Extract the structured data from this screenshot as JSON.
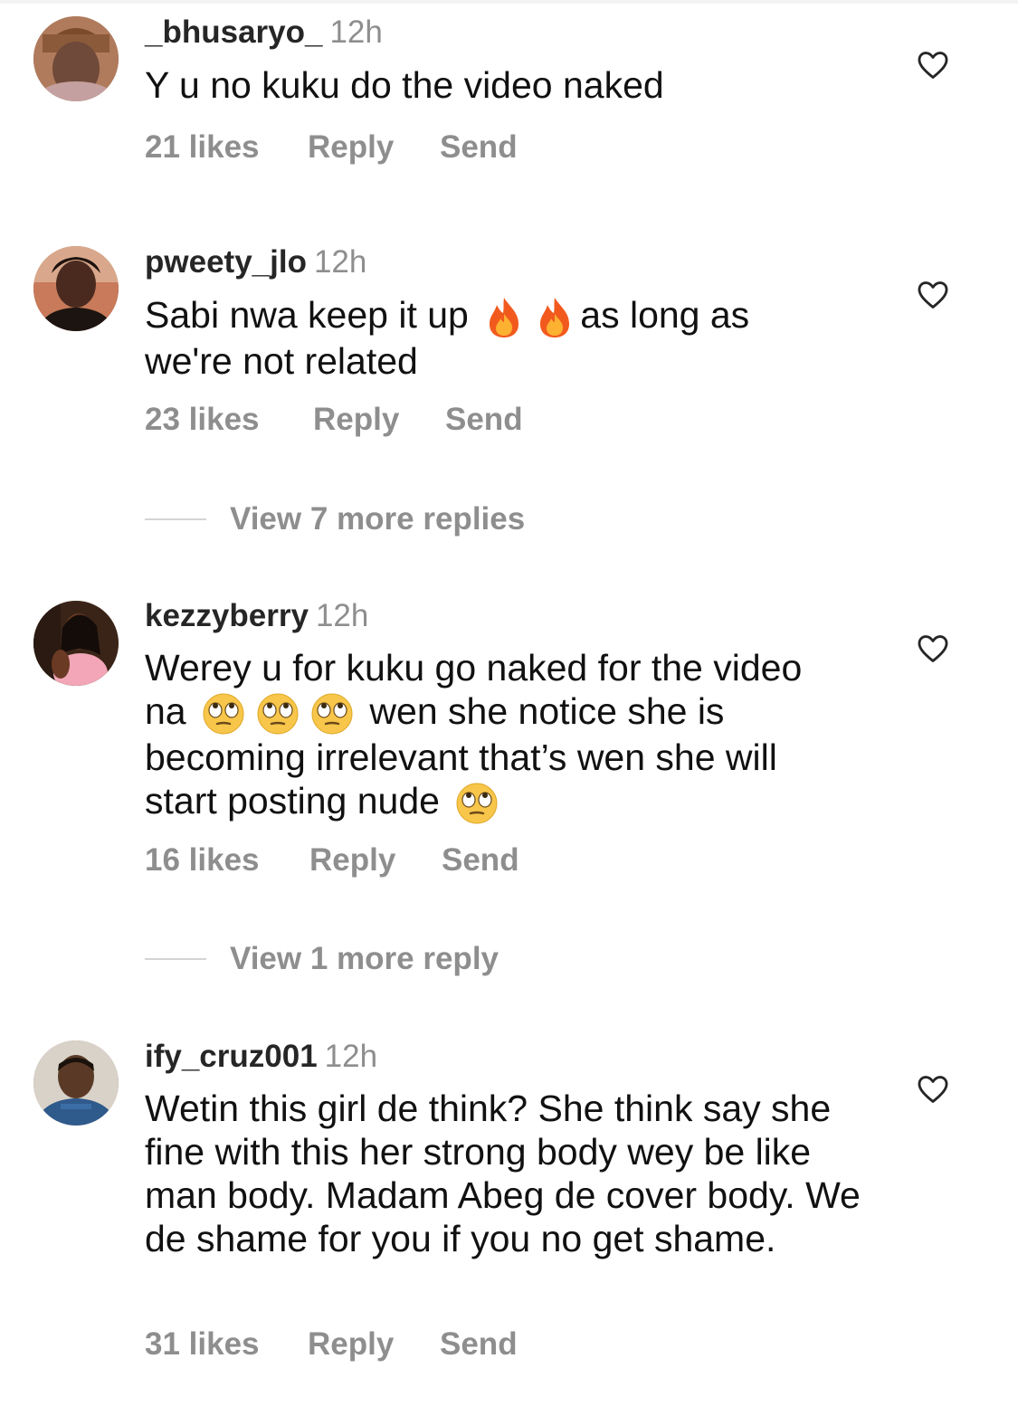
{
  "comments": [
    {
      "username": "_bhusaryo_",
      "time": "12h",
      "text": "Y u no kuku do the video naked",
      "likes": "21 likes",
      "reply": "Reply",
      "send": "Send"
    },
    {
      "username": "pweety_jlo",
      "time": "12h",
      "text_a": "Sabi nwa keep it up",
      "text_b": "as long as",
      "text_c": "we're not related",
      "likes": "23 likes",
      "reply": "Reply",
      "send": "Send",
      "view_replies": "View 7 more replies"
    },
    {
      "username": "kezzyberry",
      "time": "12h",
      "text_a": "Werey u for kuku go naked for the video",
      "text_b": "na",
      "text_c": "wen she notice she is",
      "text_d": "becoming irrelevant that’s wen she will",
      "text_e": "start posting nude",
      "likes": "16 likes",
      "reply": "Reply",
      "send": "Send",
      "view_replies": "View 1 more reply"
    },
    {
      "username": "ify_cruz001",
      "time": "12h",
      "text": "Wetin this girl de think? She think say she fine with this her strong body wey be like man body.  Madam Abeg de cover body. We de shame for you if you no get shame.",
      "likes": "31 likes",
      "reply": "Reply",
      "send": "Send"
    }
  ],
  "icons": {
    "like": "heart-outline-icon",
    "fire": "fire-emoji",
    "eye_roll": "face-with-rolling-eyes-emoji"
  },
  "colors": {
    "text": "#111111",
    "muted": "#8e8e8e",
    "username": "#262626",
    "divider": "#d4d4d4"
  }
}
